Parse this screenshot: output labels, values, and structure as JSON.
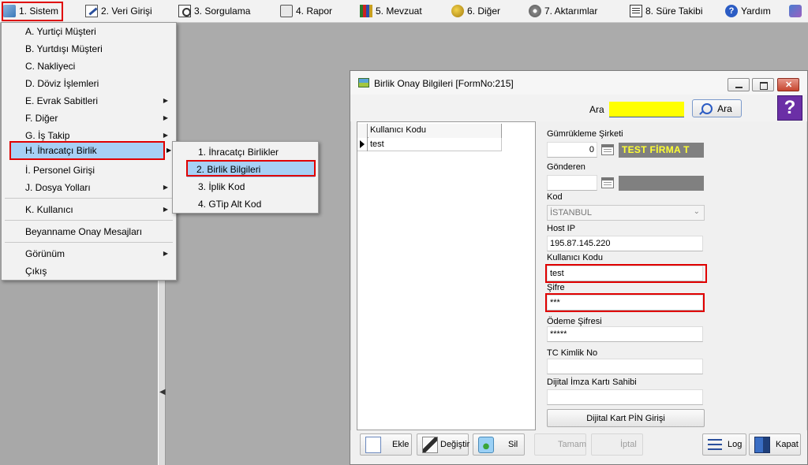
{
  "menubar": {
    "items": [
      {
        "label": "1.  Sistem",
        "icon": "system-icon"
      },
      {
        "label": "2.  Veri Girişi",
        "icon": "data-entry-icon"
      },
      {
        "label": "3.  Sorgulama",
        "icon": "query-icon"
      },
      {
        "label": "4.  Rapor",
        "icon": "printer-icon"
      },
      {
        "label": "5.  Mevzuat",
        "icon": "books-icon"
      },
      {
        "label": "6.  Diğer",
        "icon": "coins-icon"
      },
      {
        "label": "7.  Aktarımlar",
        "icon": "disc-icon"
      },
      {
        "label": "8. Süre Takibi",
        "icon": "schedule-icon"
      },
      {
        "label": "Yardım",
        "icon": "help-icon"
      }
    ]
  },
  "sistem_menu": {
    "items": [
      {
        "label": "A.  Yurtiçi Müşteri"
      },
      {
        "label": "B.  Yurtdışı Müşteri"
      },
      {
        "label": "C.  Nakliyeci"
      },
      {
        "label": "D.  Döviz İşlemleri"
      },
      {
        "label": "E.  Evrak Sabitleri"
      },
      {
        "label": "F.  Diğer"
      },
      {
        "label": "G.  İş Takip"
      },
      {
        "label": "H.  İhracatçı Birlik"
      },
      {
        "label": "İ.   Personel Girişi"
      },
      {
        "label": "J.  Dosya Yolları"
      },
      {
        "label": "K.  Kullanıcı"
      },
      {
        "label": "Beyanname Onay Mesajları"
      },
      {
        "label": "Görünüm"
      },
      {
        "label": "Çıkış"
      }
    ]
  },
  "birlik_menu": {
    "items": [
      {
        "label": "1.  İhracatçı Birlikler"
      },
      {
        "label": "2.  Birlik Bilgileri"
      },
      {
        "label": "3.  İplik Kod"
      },
      {
        "label": "4.  GTip Alt Kod"
      }
    ]
  },
  "window": {
    "title": "Birlik Onay Bilgileri [FormNo:215]",
    "search": {
      "label": "Ara",
      "value": "",
      "button": "Ara"
    },
    "help_label": "?",
    "grid": {
      "column": "Kullanıcı Kodu",
      "rows": [
        "test"
      ]
    },
    "form": {
      "gumrukleme_label": "Gümrükleme Şirketi",
      "gumrukleme_code": "0",
      "gumrukleme_name": "TEST FİRMA T",
      "gonderen_label": "Gönderen",
      "gonderen_code": "",
      "gonderen_name": "",
      "kod_label": "Kod",
      "kod_value": "İSTANBUL",
      "host_label": "Host IP",
      "host_value": "195.87.145.220",
      "kullanici_label": "Kullanıcı Kodu",
      "kullanici_value": "test",
      "sifre_label": "Şifre",
      "sifre_value": "***",
      "odeme_label": "Ödeme Şifresi",
      "odeme_value": "*****",
      "tc_label": "TC Kimlik No",
      "tc_value": "",
      "imza_label": "Dijital İmza Kartı Sahibi",
      "imza_value": "",
      "pin_button": "Dijital Kart PİN Girişi"
    },
    "toolbar": {
      "ekle": "Ekle",
      "degistir": "Değiştir",
      "sil": "Sil",
      "tamam": "Tamam",
      "iptal": "İptal",
      "log": "Log",
      "kapat": "Kapat"
    }
  },
  "colors": {
    "highlight": "#a7d0f5",
    "annotation": "#e00000",
    "search_field": "#ffff00",
    "firm_text": "#ffff33"
  }
}
